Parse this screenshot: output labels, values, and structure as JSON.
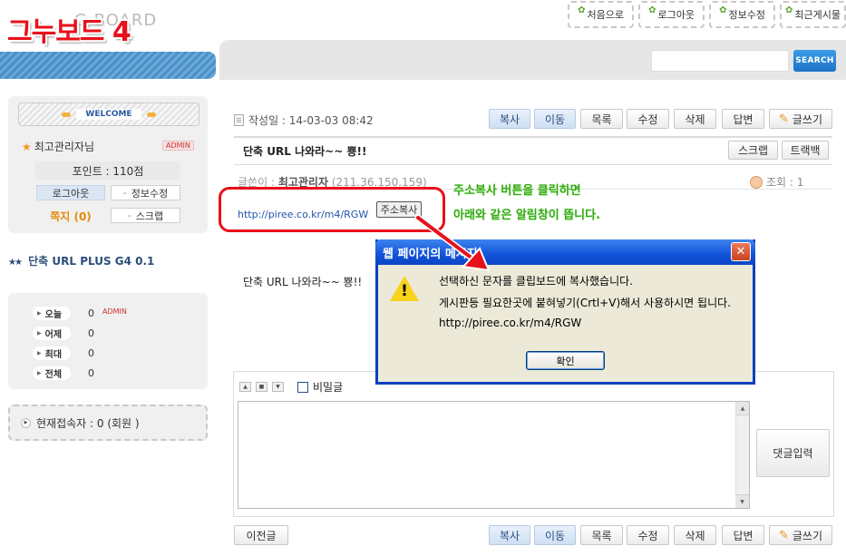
{
  "header": {
    "logo_text": "그누보드 4",
    "logo_sub": "G BOARD",
    "nav": [
      "처음으로",
      "로그아웃",
      "정보수정",
      "최근게시물"
    ],
    "search_button": "SEARCH"
  },
  "sidebar": {
    "welcome": "WELCOME",
    "user_name": "최고관리자님",
    "admin_badge": "ADMIN",
    "points": "포인트 : 110점",
    "logout": "로그아웃",
    "edit_info": "정보수정",
    "memo": "쪽지 (0)",
    "scrap": "스크랩",
    "board_title": "단축 URL PLUS G4 0.1",
    "stats": [
      {
        "label": "오늘",
        "value": "0",
        "badge": "ADMIN"
      },
      {
        "label": "어제",
        "value": "0"
      },
      {
        "label": "최대",
        "value": "0"
      },
      {
        "label": "전체",
        "value": "0"
      }
    ],
    "online": "현재접속자 : 0 (회원 )"
  },
  "post": {
    "date_line": "작성일 : 14-03-03 08:42",
    "toolbar": [
      "복사",
      "이동",
      "목록",
      "수정",
      "삭제",
      "답변"
    ],
    "write": "글쓰기",
    "title": "단축 URL 나와라~~ 뿅!!",
    "scrap_btn": "스크랩",
    "trackback_btn": "트랙백",
    "author_label": "글쓴이 :",
    "author": "최고관리자",
    "author_ip": "(211.36.150.159)",
    "views": "조회 : 1",
    "url": "http://piree.co.kr/m4/RGW",
    "copy_btn": "주소복사",
    "body": "단축 URL 나와라~~ 뿅!!",
    "note_line1": "주소복사 버튼을 클릭하면",
    "note_line2": "아래와 같은 알림창이 뜹니다."
  },
  "comment": {
    "secret": "비밀글",
    "submit": "댓글입력",
    "prev": "이전글"
  },
  "dialog": {
    "title": "웹 페이지의 메시지",
    "line1": "선택하신 문자를 클립보드에 복사했습니다.",
    "line2": "게시판등 필요한곳에 붙혀넣기(Crtl+V)해서 사용하시면 됩니다.",
    "line3": "http://piree.co.kr/m4/RGW",
    "ok": "확인"
  }
}
